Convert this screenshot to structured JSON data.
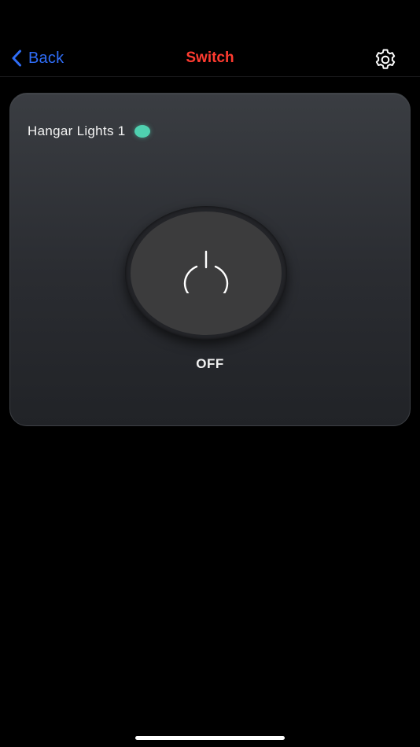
{
  "nav": {
    "back_label": "Back",
    "title": "Switch",
    "back_icon": "chevron-left-icon",
    "settings_icon": "gear-icon"
  },
  "device": {
    "name": "Hangar Lights 1",
    "status_color": "#4fd1b0",
    "power_icon": "power-icon",
    "state_label": "OFF"
  },
  "colors": {
    "accent_blue": "#2f6df6",
    "title_red": "#ff3b30",
    "status_teal": "#4fd1b0"
  }
}
